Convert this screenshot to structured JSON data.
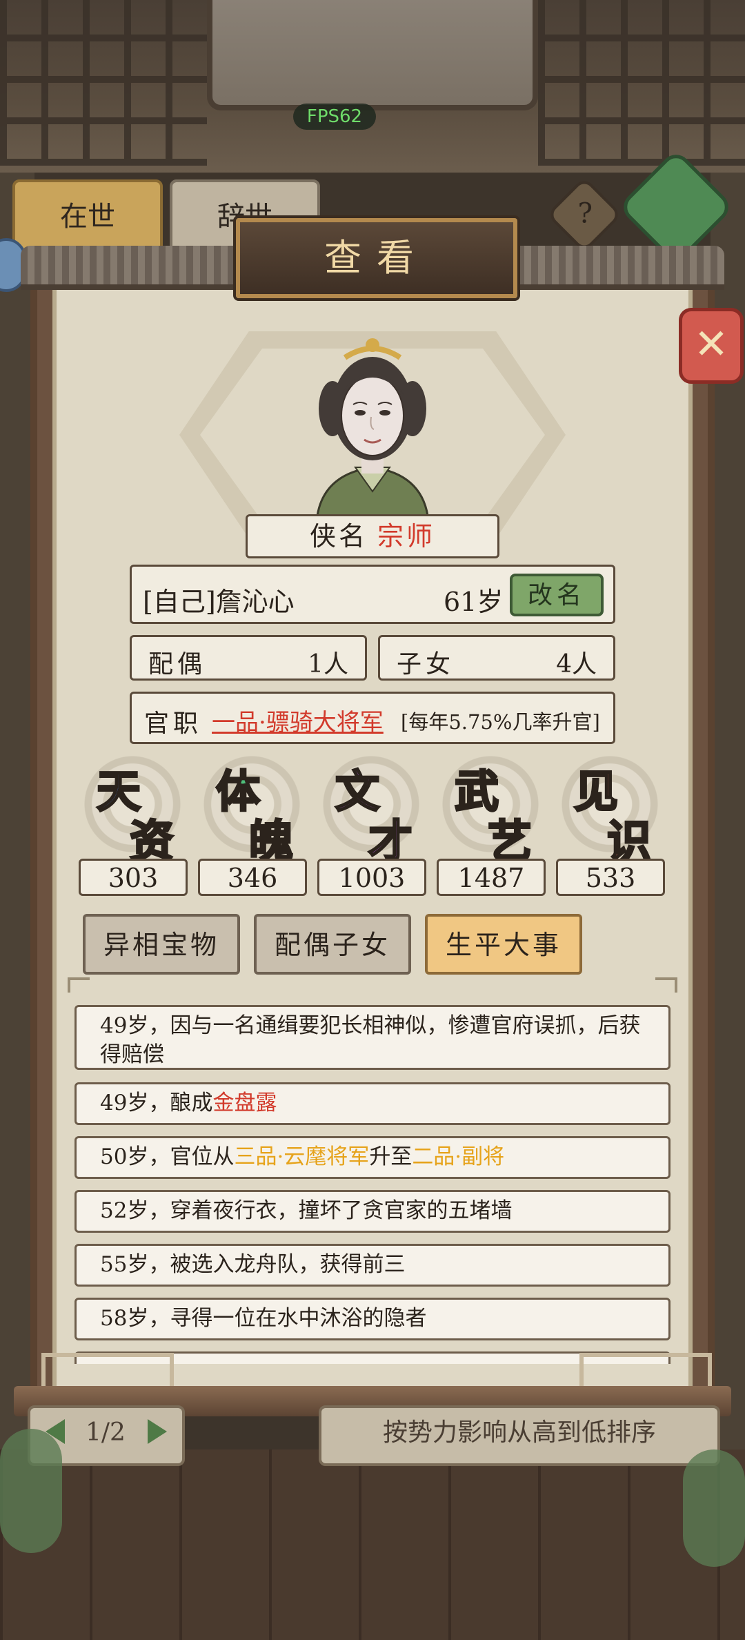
{
  "fps": "FPS62",
  "background": {
    "tab_alive": "在世",
    "tab_dead": "辞世",
    "help": "?",
    "pager": "1/2",
    "sort_button": "按势力影响从高到低排序"
  },
  "title": "查看",
  "close_label": "✕",
  "nickname": {
    "label": "侠名",
    "value": "宗师"
  },
  "character": {
    "name": "[自己]詹沁心",
    "age": "61岁",
    "rename_button": "改名"
  },
  "spouse": {
    "label": "配偶",
    "value": "1人"
  },
  "children": {
    "label": "子女",
    "value": "4人"
  },
  "office": {
    "label": "官职",
    "value": "一品·骠骑大将军",
    "note": "[每年5.75%几率升官]"
  },
  "stats": [
    {
      "c1": "天",
      "c2": "资",
      "value": "303",
      "color": "#4f7fe0"
    },
    {
      "c1": "体",
      "c2": "魄",
      "value": "346",
      "color": "#4fbf7a"
    },
    {
      "c1": "文",
      "c2": "才",
      "value": "1003",
      "color": "#b25fd8"
    },
    {
      "c1": "武",
      "c2": "艺",
      "value": "1487",
      "color": "#e8b33c"
    },
    {
      "c1": "见",
      "c2": "识",
      "value": "533",
      "color": "#e36b61"
    }
  ],
  "tabs": [
    {
      "label": "异相宝物",
      "active": false
    },
    {
      "label": "配偶子女",
      "active": false
    },
    {
      "label": "生平大事",
      "active": true
    }
  ],
  "events": [
    {
      "parts": [
        {
          "text": "49岁，因与一名通缉要犯长相神似，惨遭官府误抓，后获得赔偿"
        }
      ]
    },
    {
      "parts": [
        {
          "text": "49岁，酿成"
        },
        {
          "text": "金盘露",
          "style": "red"
        }
      ]
    },
    {
      "parts": [
        {
          "text": "50岁，官位从"
        },
        {
          "text": "三品·云麾将军",
          "style": "gold"
        },
        {
          "text": "升至"
        },
        {
          "text": "二品·副将",
          "style": "gold"
        }
      ]
    },
    {
      "parts": [
        {
          "text": "52岁，穿着夜行衣，撞坏了贪官家的五堵墙"
        }
      ]
    },
    {
      "parts": [
        {
          "text": "55岁，被选入龙舟队，获得前三"
        }
      ]
    },
    {
      "parts": [
        {
          "text": "58岁，寻得一位在水中沐浴的隐者"
        }
      ]
    }
  ]
}
